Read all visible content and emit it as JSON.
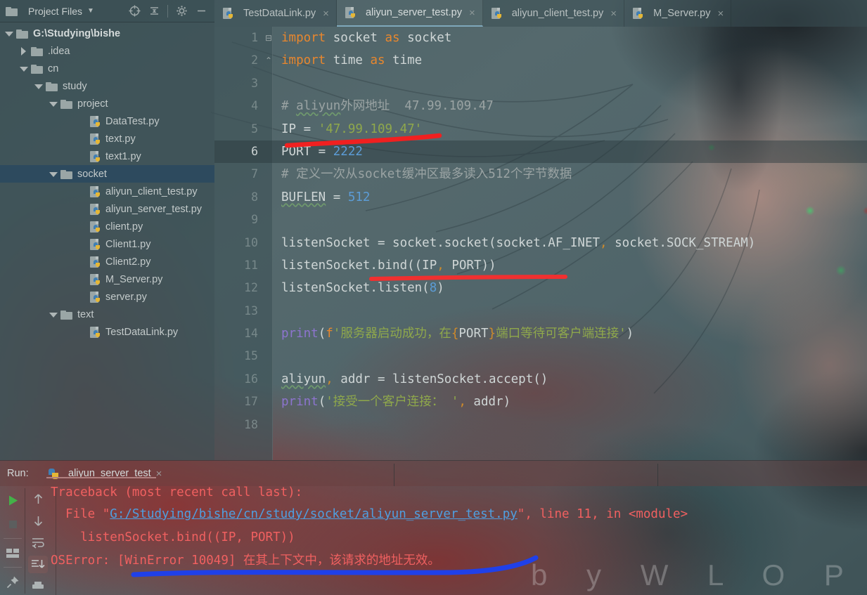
{
  "window": {
    "watermark": "b y   W L O P"
  },
  "project_panel": {
    "title": "Project Files",
    "chevron": "dropdown-caret",
    "icons": [
      "locate-target-icon",
      "collapse-all-icon",
      "gear-icon",
      "minimize-icon"
    ],
    "tree": [
      {
        "label": "G:\\Studying\\bishe",
        "type": "folder",
        "indent": 0,
        "state": "open",
        "selected": false,
        "bold": true
      },
      {
        "label": ".idea",
        "type": "folder",
        "indent": 1,
        "state": "closed",
        "selected": false,
        "bold": false
      },
      {
        "label": "cn",
        "type": "folder",
        "indent": 1,
        "state": "open",
        "selected": false,
        "bold": false
      },
      {
        "label": "study",
        "type": "folder",
        "indent": 2,
        "state": "open",
        "selected": false,
        "bold": false
      },
      {
        "label": "project",
        "type": "folder",
        "indent": 3,
        "state": "open",
        "selected": false,
        "bold": false
      },
      {
        "label": "DataTest.py",
        "type": "python",
        "indent": 5,
        "state": "",
        "selected": false,
        "bold": false
      },
      {
        "label": "text.py",
        "type": "python",
        "indent": 5,
        "state": "",
        "selected": false,
        "bold": false
      },
      {
        "label": "text1.py",
        "type": "python",
        "indent": 5,
        "state": "",
        "selected": false,
        "bold": false
      },
      {
        "label": "socket",
        "type": "folder",
        "indent": 3,
        "state": "open",
        "selected": true,
        "bold": false
      },
      {
        "label": "aliyun_client_test.py",
        "type": "python",
        "indent": 5,
        "state": "",
        "selected": false,
        "bold": false
      },
      {
        "label": "aliyun_server_test.py",
        "type": "python",
        "indent": 5,
        "state": "",
        "selected": false,
        "bold": false
      },
      {
        "label": "client.py",
        "type": "python",
        "indent": 5,
        "state": "",
        "selected": false,
        "bold": false
      },
      {
        "label": "Client1.py",
        "type": "python",
        "indent": 5,
        "state": "",
        "selected": false,
        "bold": false
      },
      {
        "label": "Client2.py",
        "type": "python",
        "indent": 5,
        "state": "",
        "selected": false,
        "bold": false
      },
      {
        "label": "M_Server.py",
        "type": "python",
        "indent": 5,
        "state": "",
        "selected": false,
        "bold": false
      },
      {
        "label": "server.py",
        "type": "python",
        "indent": 5,
        "state": "",
        "selected": false,
        "bold": false
      },
      {
        "label": "text",
        "type": "folder",
        "indent": 3,
        "state": "open",
        "selected": false,
        "bold": false
      },
      {
        "label": "TestDataLink.py",
        "type": "python",
        "indent": 5,
        "state": "",
        "selected": false,
        "bold": false
      }
    ]
  },
  "editor": {
    "tabs": [
      {
        "label": "TestDataLink.py",
        "active": false,
        "close": "×"
      },
      {
        "label": "aliyun_server_test.py",
        "active": true,
        "close": "×"
      },
      {
        "label": "aliyun_client_test.py",
        "active": false,
        "close": "×"
      },
      {
        "label": "M_Server.py",
        "active": false,
        "close": "×"
      }
    ],
    "current_line": 6,
    "lines": [
      {
        "n": "1",
        "fold": "⊟"
      },
      {
        "n": "2",
        "fold": "⌃"
      },
      {
        "n": "3",
        "fold": ""
      },
      {
        "n": "4",
        "fold": ""
      },
      {
        "n": "5",
        "fold": ""
      },
      {
        "n": "6",
        "fold": ""
      },
      {
        "n": "7",
        "fold": ""
      },
      {
        "n": "8",
        "fold": ""
      },
      {
        "n": "9",
        "fold": ""
      },
      {
        "n": "10",
        "fold": ""
      },
      {
        "n": "11",
        "fold": ""
      },
      {
        "n": "12",
        "fold": ""
      },
      {
        "n": "13",
        "fold": ""
      },
      {
        "n": "14",
        "fold": ""
      },
      {
        "n": "15",
        "fold": ""
      },
      {
        "n": "16",
        "fold": ""
      },
      {
        "n": "17",
        "fold": ""
      },
      {
        "n": "18",
        "fold": ""
      }
    ],
    "code": {
      "l1_kw": "import",
      "l1_rest": " socket ",
      "l1_as": "as",
      "l1_tail": " socket",
      "l2_kw": "import",
      "l2_rest": " time ",
      "l2_as": "as",
      "l2_tail": " time",
      "l4": "# aliyun外网地址  47.99.109.47",
      "l4_a": "# ",
      "l4_b": "aliyun",
      "l4_c": "外网地址  47.99.109.47",
      "l5_name": "IP = ",
      "l5_str": "'47.99.109.47'",
      "l6_name": "PORT = ",
      "l6_num": "2222",
      "l7": "# 定义一次从socket缓冲区最多读入512个字节数据",
      "l8_name": "BUFLEN",
      "l8_eq": " = ",
      "l8_num": "512",
      "l10": "listenSocket = socket.socket(socket.AF_INET",
      "l10_comma": ",",
      "l10_tail": " socket.SOCK_STREAM)",
      "l11": "listenSocket.bind((IP",
      "l11_comma": ",",
      "l11_tail": " PORT))",
      "l12_a": "listenSocket.listen(",
      "l12_num": "8",
      "l12_b": ")",
      "l14_fn": "print",
      "l14_p1": "(",
      "l14_f": "f",
      "l14_s1": "'服务器启动成功，在",
      "l14_brace1": "{",
      "l14_port": "PORT",
      "l14_brace2": "}",
      "l14_s2": "端口等待可客户端连接'",
      "l14_p2": ")",
      "l16_a": "aliyun",
      "l16_comma": ",",
      "l16_b": " addr = listenSocket.accept()",
      "l17_fn": "print",
      "l17_p1": "(",
      "l17_s": "'接受一个客户连接： '",
      "l17_comma": ",",
      "l17_b": " addr)"
    }
  },
  "run_panel": {
    "label": "Run:",
    "tab": "aliyun_server_test",
    "tab_close": "×",
    "toolbar_icons": [
      "run-icon",
      "stop-icon",
      "layout-icon",
      "pin-icon",
      "up-arrow-icon",
      "down-arrow-icon",
      "soft-wrap-icon",
      "scroll-to-end-icon",
      "print-icon"
    ],
    "console": {
      "line1": "Traceback (most recent call last):",
      "line2_pre": "  File \"",
      "line2_link": "G:/Studying/bishe/cn/study/socket/aliyun_server_test.py",
      "line2_post": "\", line 11, in <module>",
      "line3": "    listenSocket.bind((IP, PORT))",
      "line4": "OSError: [WinError 10049] 在其上下文中，该请求的地址无效。"
    }
  },
  "annotations": [
    {
      "name": "red-underline-ip-value",
      "color": "#f02020"
    },
    {
      "name": "red-underline-bind-call",
      "color": "#f03030"
    },
    {
      "name": "blue-underline-oserror",
      "color": "#2040e8"
    }
  ],
  "colors": {
    "keyword": "#e8872e",
    "string": "#8fa84b",
    "number": "#5c9cd6",
    "comment": "#9aa3a3",
    "function": "#8d74cf",
    "error": "#f06060",
    "link": "#4f9fe0",
    "selection": "#2d4a5e"
  }
}
